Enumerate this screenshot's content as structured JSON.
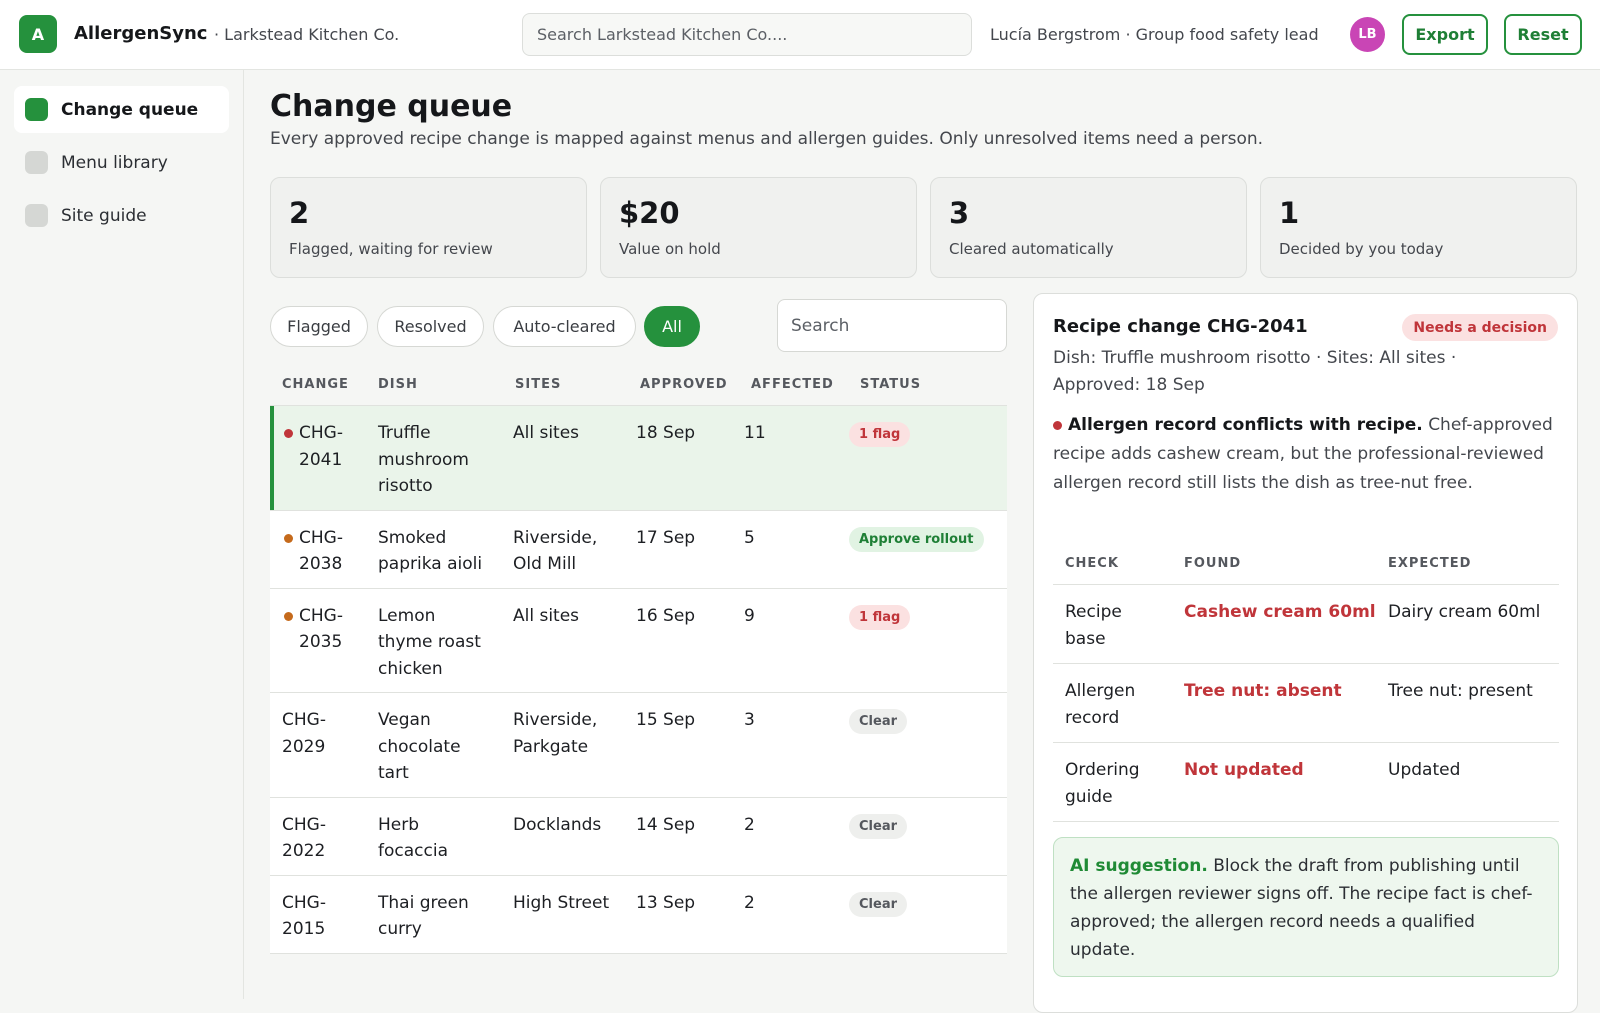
{
  "app": {
    "logo_letter": "A",
    "name": "AllergenSync",
    "org": "· Larkstead Kitchen Co.",
    "search_placeholder": "Search Larkstead Kitchen Co....",
    "user": "Lucía Bergstrom · Group food safety lead",
    "avatar_initials": "LB",
    "export_label": "Export",
    "reset_label": "Reset",
    "accent": "#25913d"
  },
  "sidebar": {
    "items": [
      {
        "label": "Change queue",
        "active": true
      },
      {
        "label": "Menu library",
        "active": false
      },
      {
        "label": "Site guide",
        "active": false
      }
    ]
  },
  "page": {
    "title": "Change queue",
    "subtitle": "Every approved recipe change is mapped against menus and allergen guides. Only unresolved items need a person."
  },
  "stats": [
    {
      "value": "2",
      "label": "Flagged, waiting for review"
    },
    {
      "value": "$20",
      "label": "Value on hold"
    },
    {
      "value": "3",
      "label": "Cleared automatically"
    },
    {
      "value": "1",
      "label": "Decided by you today"
    }
  ],
  "filters": {
    "items": [
      "Flagged",
      "Resolved",
      "Auto-cleared",
      "All"
    ],
    "active": "All",
    "search_placeholder": "Search"
  },
  "table": {
    "headers": [
      "CHANGE",
      "DISH",
      "SITES",
      "APPROVED",
      "AFFECTED",
      "STATUS"
    ],
    "rows": [
      {
        "change": "CHG-\n2041",
        "dish": "Truffle\nmushroom\nrisotto",
        "sites": "All sites",
        "approved": "18 Sep",
        "affected": "11",
        "status": "1 flag",
        "status_kind": "flag",
        "dot": "#c0353a",
        "selected": true
      },
      {
        "change": "CHG-\n2038",
        "dish": "Smoked\npaprika aioli",
        "sites": "Riverside,\nOld Mill",
        "approved": "17 Sep",
        "affected": "5",
        "status": "Approve rollout",
        "status_kind": "approve",
        "dot": "#c56a1c",
        "selected": false
      },
      {
        "change": "CHG-\n2035",
        "dish": "Lemon\nthyme roast\nchicken",
        "sites": "All sites",
        "approved": "16 Sep",
        "affected": "9",
        "status": "1 flag",
        "status_kind": "flag",
        "dot": "#c56a1c",
        "selected": false
      },
      {
        "change": "CHG-\n2029",
        "dish": "Vegan\nchocolate\ntart",
        "sites": "Riverside,\nParkgate",
        "approved": "15 Sep",
        "affected": "3",
        "status": "Clear",
        "status_kind": "clear",
        "dot": null,
        "selected": false
      },
      {
        "change": "CHG-\n2022",
        "dish": "Herb\nfocaccia",
        "sites": "Docklands",
        "approved": "14 Sep",
        "affected": "2",
        "status": "Clear",
        "status_kind": "clear",
        "dot": null,
        "selected": false
      },
      {
        "change": "CHG-\n2015",
        "dish": "Thai green\ncurry",
        "sites": "High Street",
        "approved": "13 Sep",
        "affected": "2",
        "status": "Clear",
        "status_kind": "clear",
        "dot": null,
        "selected": false
      }
    ]
  },
  "detail": {
    "title": "Recipe change CHG-2041",
    "badge": "Needs a decision",
    "meta": "Dish: Truffle mushroom risotto · Sites: All sites · Approved: 18 Sep",
    "conflict_title": "Allergen record conflicts with recipe.",
    "conflict_text": "Chef-approved recipe adds cashew cream, but the professional-reviewed allergen record still lists the dish as tree-nut free.",
    "check_headers": [
      "CHECK",
      "FOUND",
      "EXPECTED"
    ],
    "checks": [
      {
        "check": "Recipe\nbase",
        "found": "Cashew cream 60ml",
        "expected": "Dairy cream 60ml"
      },
      {
        "check": "Allergen\nrecord",
        "found": "Tree nut: absent",
        "expected": "Tree nut: present"
      },
      {
        "check": "Ordering\nguide",
        "found": "Not updated",
        "expected": "Updated"
      }
    ],
    "ai_label": "AI suggestion.",
    "ai_text": "Block the draft from publishing until the allergen reviewer signs off. The recipe fact is chef-approved; the allergen record needs a qualified update."
  }
}
